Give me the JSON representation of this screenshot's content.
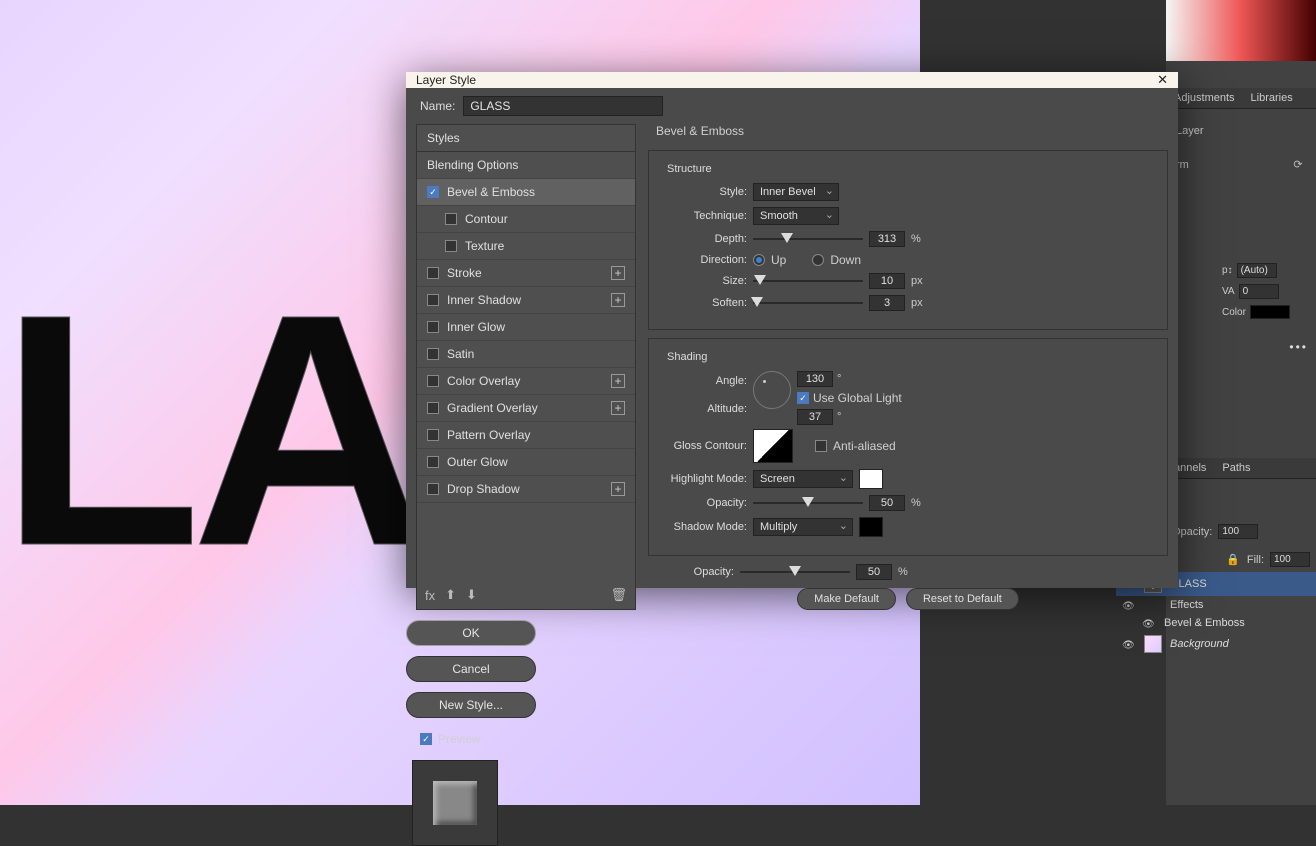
{
  "canvas_text": "LA",
  "dialog": {
    "title": "Layer Style",
    "name_label": "Name:",
    "name_value": "GLASS",
    "close": "✕",
    "styles_header": "Styles",
    "blending_options": "Blending Options",
    "effects": [
      {
        "label": "Bevel & Emboss",
        "checked": true,
        "selected": true,
        "plus": false
      },
      {
        "label": "Contour",
        "checked": false,
        "sub": true
      },
      {
        "label": "Texture",
        "checked": false,
        "sub": true
      },
      {
        "label": "Stroke",
        "checked": false,
        "plus": true
      },
      {
        "label": "Inner Shadow",
        "checked": false,
        "plus": true
      },
      {
        "label": "Inner Glow",
        "checked": false
      },
      {
        "label": "Satin",
        "checked": false
      },
      {
        "label": "Color Overlay",
        "checked": false,
        "plus": true
      },
      {
        "label": "Gradient Overlay",
        "checked": false,
        "plus": true
      },
      {
        "label": "Pattern Overlay",
        "checked": false
      },
      {
        "label": "Outer Glow",
        "checked": false
      },
      {
        "label": "Drop Shadow",
        "checked": false,
        "plus": true
      }
    ],
    "footer_icons": {
      "fx": "fx",
      "up": "⬆",
      "down": "⬇",
      "trash": "🗑"
    },
    "group_title": "Bevel & Emboss",
    "structure": {
      "title": "Structure",
      "style_label": "Style:",
      "style_value": "Inner Bevel",
      "technique_label": "Technique:",
      "technique_value": "Smooth",
      "depth_label": "Depth:",
      "depth_value": "313",
      "depth_unit": "%",
      "direction_label": "Direction:",
      "dir_up": "Up",
      "dir_down": "Down",
      "size_label": "Size:",
      "size_value": "10",
      "size_unit": "px",
      "soften_label": "Soften:",
      "soften_value": "3",
      "soften_unit": "px"
    },
    "shading": {
      "title": "Shading",
      "angle_label": "Angle:",
      "angle_value": "130",
      "angle_unit": "°",
      "global_light": "Use Global Light",
      "altitude_label": "Altitude:",
      "altitude_value": "37",
      "altitude_unit": "°",
      "gloss_label": "Gloss Contour:",
      "anti_aliased": "Anti-aliased",
      "highlight_label": "Highlight Mode:",
      "highlight_value": "Screen",
      "highlight_color": "#ffffff",
      "opacity_label": "Opacity:",
      "highlight_opacity": "50",
      "shadow_label": "Shadow Mode:",
      "shadow_value": "Multiply",
      "shadow_color": "#000000",
      "shadow_opacity": "50",
      "pct": "%"
    },
    "make_default": "Make Default",
    "reset_default": "Reset to Default",
    "actions": {
      "ok": "OK",
      "cancel": "Cancel",
      "new_style": "New Style...",
      "preview": "Preview"
    }
  },
  "right_panel": {
    "tabs": [
      "Adjustments",
      "Libraries"
    ],
    "layer_label": "Layer",
    "refresh_label": "rm",
    "channels_tabs": [
      "annels",
      "Paths"
    ],
    "char_auto": "(Auto)",
    "va_label": "VA",
    "va_value": "0",
    "color_label": "Color",
    "ph_label": "ph",
    "opacity_label": "Opacity:",
    "opacity_value": "100",
    "fill_label": "Fill:",
    "fill_value": "100",
    "ellipsis": "•••"
  },
  "layers": {
    "glass": "GLASS",
    "effects": "Effects",
    "bevel": "Bevel & Emboss",
    "background": "Background"
  }
}
